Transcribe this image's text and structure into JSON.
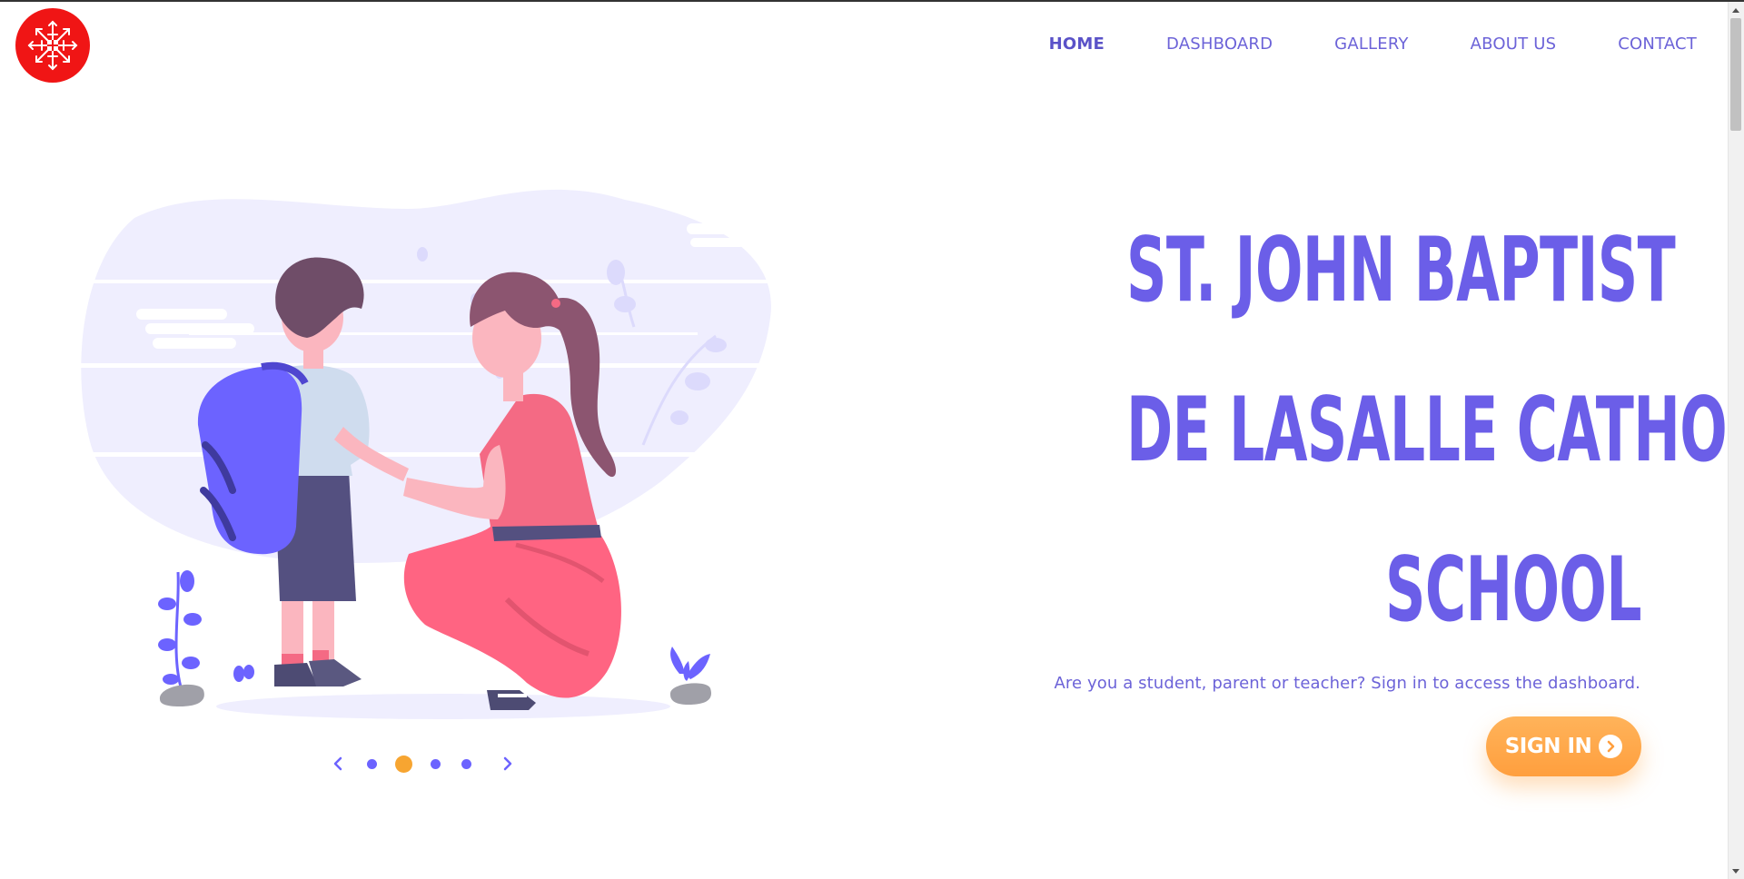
{
  "header": {
    "nav": [
      {
        "label": "HOME",
        "active": true
      },
      {
        "label": "DASHBOARD",
        "active": false
      },
      {
        "label": "GALLERY",
        "active": false
      },
      {
        "label": "ABOUT US",
        "active": false
      },
      {
        "label": "CONTACT",
        "active": false
      }
    ],
    "logo_icon": "snowflake-cross-icon"
  },
  "hero": {
    "title_lines": [
      "ST. JOHN BAPTIST",
      "DE LASALLE CATHOLIC",
      "SCHOOL"
    ],
    "subtitle": "Are you a student, parent or teacher? Sign in to access the dashboard.",
    "signin_label": "SIGN IN",
    "signin_icon": "chevron-right-circle-icon"
  },
  "carousel": {
    "total_slides": 4,
    "current_slide": 2
  },
  "colors": {
    "accent": "#6b5ee8",
    "button": "#ffa647",
    "active_dot": "#f7a531",
    "logo_bg": "#f01515"
  }
}
